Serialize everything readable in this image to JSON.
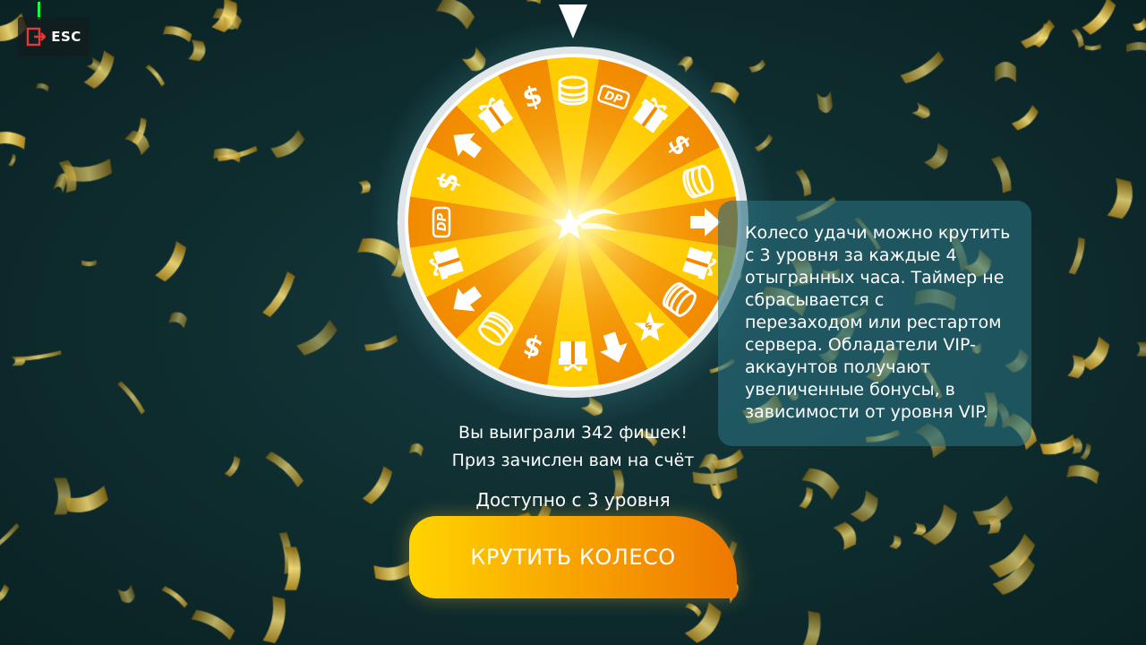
{
  "escape": {
    "label": "ESC",
    "icon": "exit-door-icon"
  },
  "wheel": {
    "segment_icons": [
      "coins-stack-icon",
      "dp-logo-icon",
      "gift-icon",
      "dollar-icon",
      "coins-stack-icon",
      "arrow-up-icon",
      "gift-icon",
      "coins-stack-icon",
      "star-icon",
      "arrow-up-icon",
      "gift-icon",
      "dollar-icon",
      "coins-stack-icon",
      "arrow-up-icon",
      "gift-icon",
      "dp-logo-icon",
      "dollar-icon",
      "arrow-up-icon",
      "gift-icon",
      "dollar-icon"
    ],
    "colors": {
      "light": "#ffcc00",
      "dark": "#f28a00",
      "center": "#fff8b0",
      "rim": "#e8ecee"
    }
  },
  "info": {
    "text": "Колесо удачи можно крутить\nс 3 уровня за каждые 4\nотыгранных часа. Таймер не\nсбрасывается с\nперезаходом или рестартом\nсервера. Обладатели VIP-\nаккаунтов получают\nувеличенные бонусы, в\nзависимости от уровня VIP."
  },
  "result": {
    "line1": "Вы выиграли 342 фишек!",
    "line2": "Приз зачислен вам на счёт"
  },
  "availability": "Доступно с 3 уровня",
  "spin_button": {
    "label": "КРУТИТЬ КОЛЕСО"
  }
}
